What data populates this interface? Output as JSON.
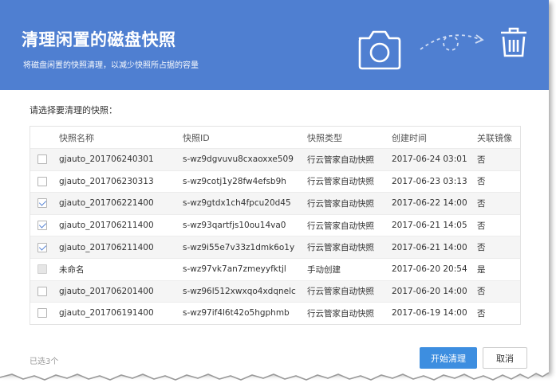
{
  "header": {
    "title": "清理闲置的磁盘快照",
    "subtitle": "将磁盘闲置的快照清理，以减少快照所占据的容量",
    "icons": [
      "camera-icon",
      "trash-icon"
    ],
    "background": "#4f7fd1"
  },
  "prompt": "请选择要清理的快照：",
  "table": {
    "columns": {
      "name": "快照名称",
      "id": "快照ID",
      "type": "快照类型",
      "created": "创建时间",
      "image": "关联镜像"
    },
    "rows": [
      {
        "name": "gjauto_201706240301",
        "id": "s-wz9dgvuvu8cxaoxxe509",
        "type": "行云管家自动快照",
        "created": "2017-06-24 03:01",
        "image": "否",
        "checked": false,
        "disabled": false
      },
      {
        "name": "gjauto_201706230313",
        "id": "s-wz9cotj1y28fw4efsb9h",
        "type": "行云管家自动快照",
        "created": "2017-06-23 03:13",
        "image": "否",
        "checked": false,
        "disabled": false
      },
      {
        "name": "gjauto_201706221400",
        "id": "s-wz9gtdx1ch4fpcu20d45",
        "type": "行云管家自动快照",
        "created": "2017-06-22 14:00",
        "image": "否",
        "checked": true,
        "disabled": false
      },
      {
        "name": "gjauto_201706211400",
        "id": "s-wz93qartfjs10ou14va0",
        "type": "行云管家自动快照",
        "created": "2017-06-21 14:05",
        "image": "否",
        "checked": true,
        "disabled": false
      },
      {
        "name": "gjauto_201706211400",
        "id": "s-wz9i55e7v33z1dmk6o1y",
        "type": "行云管家自动快照",
        "created": "2017-06-21 14:00",
        "image": "否",
        "checked": true,
        "disabled": false
      },
      {
        "name": "未命名",
        "id": "s-wz97vk7an7zmeyyfktjl",
        "type": "手动创建",
        "created": "2017-06-20 20:54",
        "image": "是",
        "checked": false,
        "disabled": true
      },
      {
        "name": "gjauto_201706201400",
        "id": "s-wz96l512xwxqo4xdqnelc",
        "type": "行云管家自动快照",
        "created": "2017-06-20 14:00",
        "image": "否",
        "checked": false,
        "disabled": false
      },
      {
        "name": "gjauto_201706191400",
        "id": "s-wz97if4l6t42o5hgphmb",
        "type": "行云管家自动快照",
        "created": "2017-06-19 14:00",
        "image": "否",
        "checked": false,
        "disabled": false
      }
    ]
  },
  "footer": {
    "selected_count": "已选3个",
    "start_button": "开始清理",
    "cancel_button": "取消",
    "primary_color": "#3d8ee0"
  }
}
